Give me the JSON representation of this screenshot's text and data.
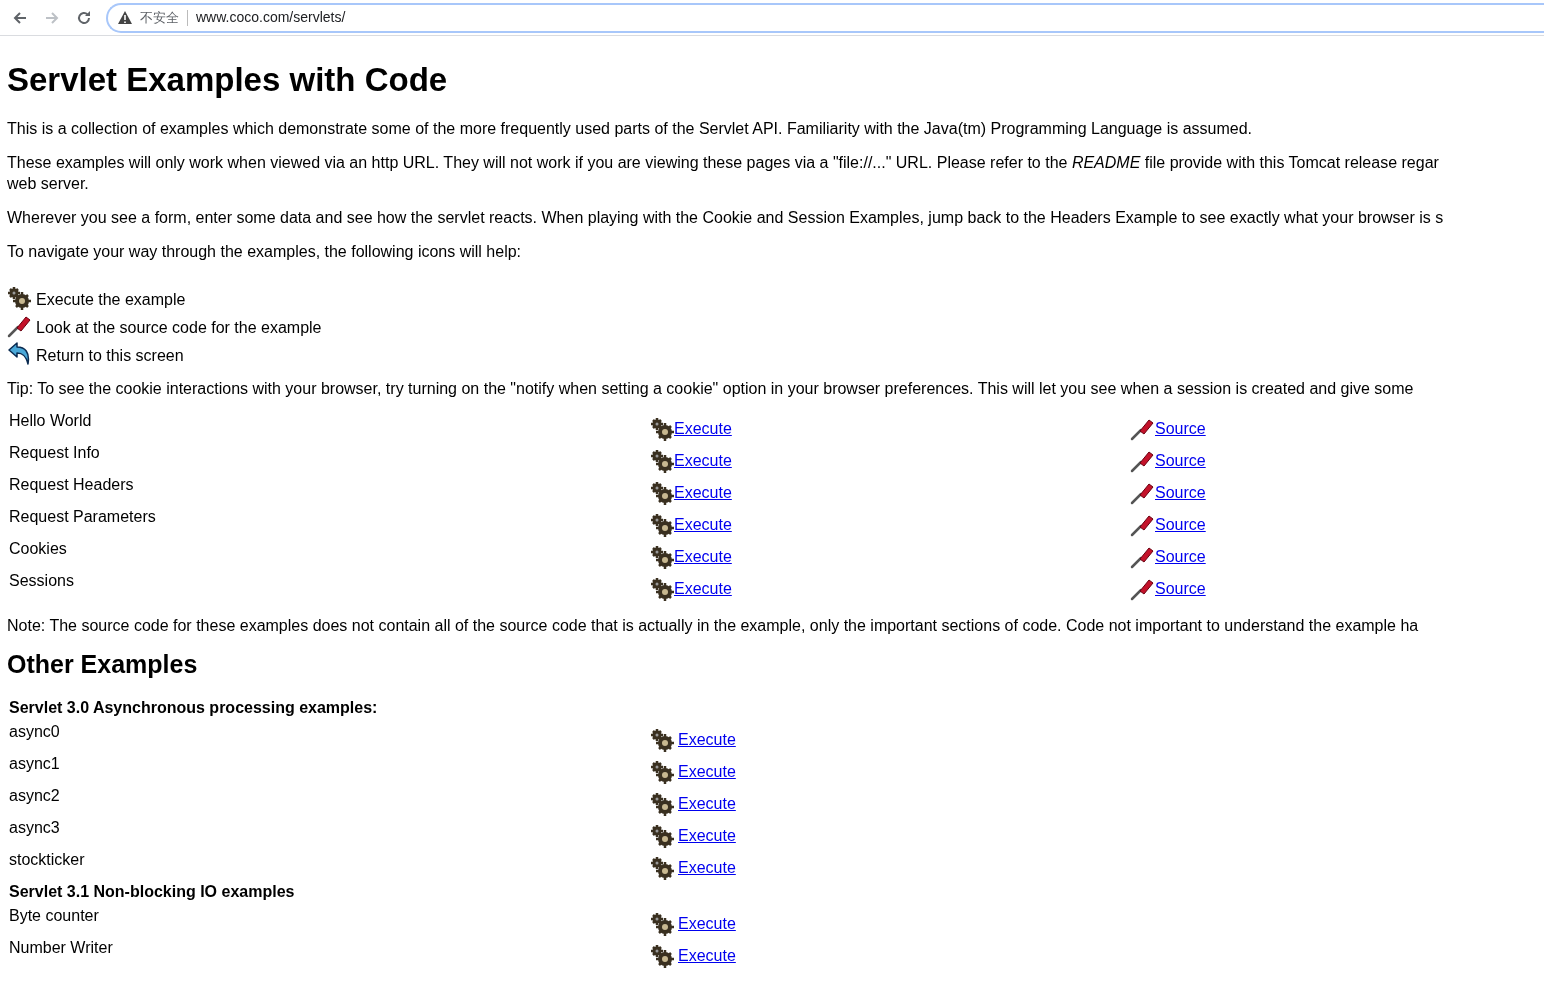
{
  "browser": {
    "security_label": "不安全",
    "url": "www.coco.com/servlets/"
  },
  "title": "Servlet Examples with Code",
  "paragraphs": [
    [
      "This is a collection of examples which demonstrate some of the more frequently used parts of the Servlet API. Familiarity with the Java(tm) Programming Language is assumed."
    ],
    [
      "These examples will only work when viewed via an http URL. They will not work if you are viewing these pages via a \"file://...\" URL. Please refer to the *README* file provide with this Tomcat release regar",
      "web server."
    ],
    [
      "Wherever you see a form, enter some data and see how the servlet reacts. When playing with the Cookie and Session Examples, jump back to the Headers Example to see exactly what your browser is s"
    ],
    [
      "To navigate your way through the examples, the following icons will help:"
    ]
  ],
  "legend": [
    {
      "kind": "execute",
      "label": "Execute the example"
    },
    {
      "kind": "source",
      "label": "Look at the source code for the example"
    },
    {
      "kind": "return",
      "label": "Return to this screen"
    }
  ],
  "tip": "Tip: To see the cookie interactions with your browser, try turning on the \"notify when setting a cookie\" option in your browser preferences. This will let you see when a session is created and give some",
  "examples": [
    {
      "name": "Hello World",
      "execute": "Execute",
      "source": "Source"
    },
    {
      "name": "Request Info",
      "execute": "Execute",
      "source": "Source"
    },
    {
      "name": "Request Headers",
      "execute": "Execute",
      "source": "Source"
    },
    {
      "name": "Request Parameters",
      "execute": "Execute",
      "source": "Source"
    },
    {
      "name": "Cookies",
      "execute": "Execute",
      "source": "Source"
    },
    {
      "name": "Sessions",
      "execute": "Execute",
      "source": "Source"
    }
  ],
  "note": "Note: The source code for these examples does not contain all of the source code that is actually in the example, only the important sections of code. Code not important to understand the example ha",
  "other_title": "Other Examples",
  "groups": [
    {
      "heading": "Servlet 3.0 Asynchronous processing examples:",
      "items": [
        {
          "name": "async0",
          "execute": "Execute"
        },
        {
          "name": "async1",
          "execute": "Execute"
        },
        {
          "name": "async2",
          "execute": "Execute"
        },
        {
          "name": "async3",
          "execute": "Execute"
        },
        {
          "name": "stockticker",
          "execute": "Execute"
        }
      ]
    },
    {
      "heading": "Servlet 3.1 Non-blocking IO examples",
      "items": [
        {
          "name": "Byte counter",
          "execute": "Execute"
        },
        {
          "name": "Number Writer",
          "execute": "Execute"
        }
      ]
    }
  ]
}
